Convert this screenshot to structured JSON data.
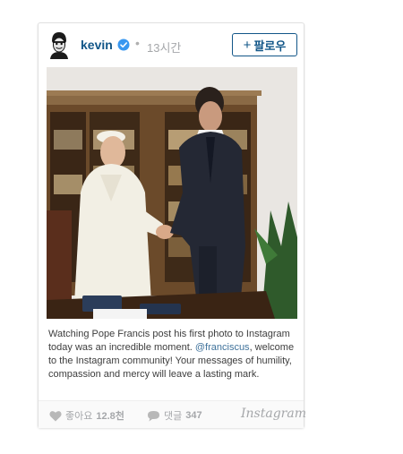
{
  "post": {
    "username": "kevin",
    "time": "13시간",
    "follow_label": "팔로우",
    "caption": {
      "line1": "Watching Pope Francis post his first photo to Instagram today was an incredible moment.",
      "mention": "@franciscus",
      "line2": ", welcome to the Instagram community! Your messages of humility, compassion and mercy will leave a lasting mark."
    },
    "likes": {
      "label": "좋아요",
      "count": "12.8천"
    },
    "comments": {
      "label": "댓글",
      "count": "347"
    },
    "brand": "Instagram"
  },
  "icons": {
    "avatar": "avatar-icon",
    "verified": "verified-badge-icon",
    "like": "heart-icon",
    "comment": "comment-bubble-icon"
  },
  "colors": {
    "link": "#125688",
    "mention": "#3f729b",
    "muted": "#a5a7aa",
    "verified": "#3897f0"
  }
}
